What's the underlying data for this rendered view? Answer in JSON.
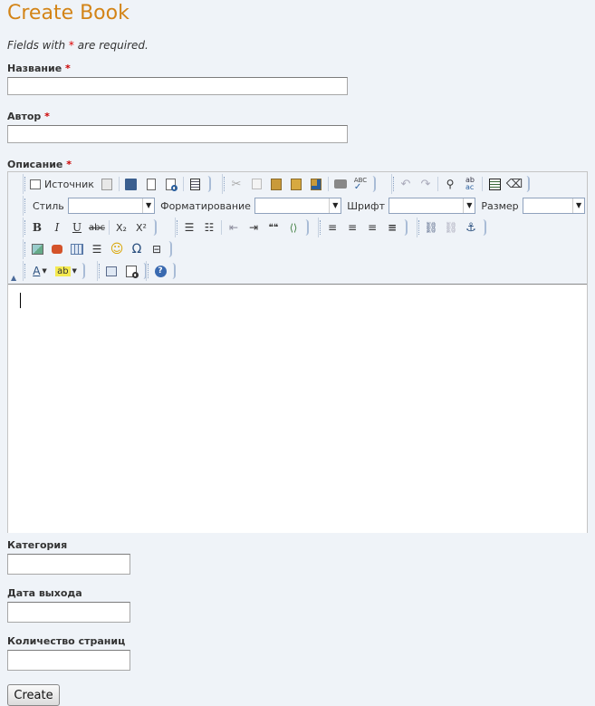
{
  "page": {
    "title": "Create Book",
    "required_note_prefix": "Fields with ",
    "required_marker": "*",
    "required_note_suffix": " are required."
  },
  "fields": {
    "name": {
      "label": "Название",
      "value": ""
    },
    "author": {
      "label": "Автор",
      "value": ""
    },
    "description": {
      "label": "Описание"
    },
    "category": {
      "label": "Категория",
      "value": ""
    },
    "release_date": {
      "label": "Дата выхода",
      "value": ""
    },
    "page_count": {
      "label": "Количество страниц",
      "value": ""
    }
  },
  "editor": {
    "source_label": "Источник",
    "style_label": "Стиль",
    "format_label": "Форматирование",
    "font_label": "Шрифт",
    "size_label": "Размер",
    "style_value": "",
    "format_value": "",
    "font_value": "",
    "size_value": "",
    "bold_glyph": "B",
    "italic_glyph": "I",
    "underline_glyph": "U",
    "strike_glyph": "abc",
    "subscript_glyph": "X₂",
    "superscript_glyph": "X²",
    "special_char_glyph": "Ω",
    "blockquote_glyph": "❝❝",
    "content": ""
  },
  "form": {
    "submit_label": "Create"
  },
  "colors": {
    "title": "#d38417",
    "required": "#cc0000",
    "background": "#eff3f8"
  }
}
